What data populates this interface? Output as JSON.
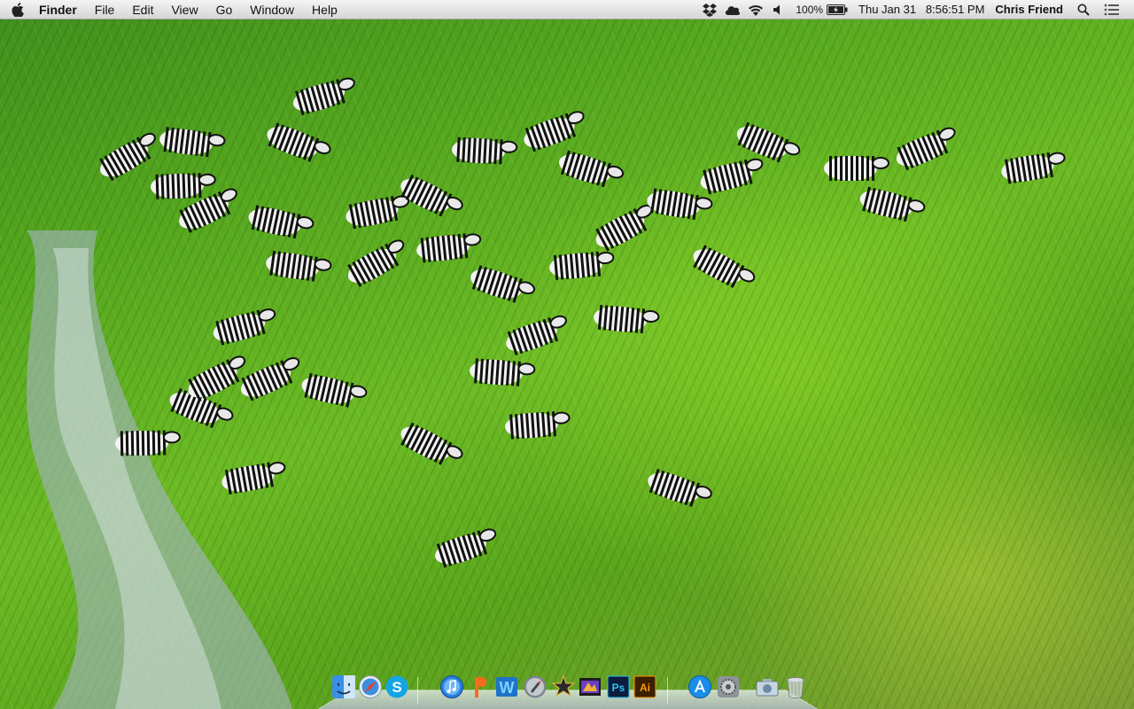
{
  "menubar": {
    "app_name": "Finder",
    "menus": [
      "File",
      "Edit",
      "View",
      "Go",
      "Window",
      "Help"
    ],
    "battery": "100%",
    "clock": "Thu Jan 31   8:56:51 PM",
    "user": "Chris Friend"
  },
  "status_icons": [
    "dropbox-icon",
    "cloud-icon",
    "wifi-icon",
    "volume-icon",
    "battery-icon",
    "spotlight-icon",
    "notification-center-icon"
  ],
  "dock": {
    "items": [
      {
        "name": "finder",
        "label_text": ""
      },
      {
        "name": "safari",
        "label_text": ""
      },
      {
        "name": "skype",
        "label_text": "S"
      },
      {
        "name": "itunes",
        "label_text": ""
      },
      {
        "name": "pages",
        "label_text": ""
      },
      {
        "name": "word",
        "label_text": "W"
      },
      {
        "name": "launchpad",
        "label_text": ""
      },
      {
        "name": "imovie",
        "label_text": ""
      },
      {
        "name": "final-cut",
        "label_text": ""
      },
      {
        "name": "photoshop",
        "label_text": "Ps"
      },
      {
        "name": "illustrator",
        "label_text": "Ai"
      },
      {
        "name": "app-store",
        "label_text": ""
      },
      {
        "name": "system-preferences",
        "label_text": ""
      },
      {
        "name": "image-capture",
        "label_text": ""
      },
      {
        "name": "trash",
        "label_text": ""
      }
    ]
  },
  "colors": {
    "grass": "#5aa51c",
    "menubar": "#e8e8e8",
    "skype": "#12a5e6",
    "photoshop": "#0b1c3c",
    "illustrator": "#3a1f00"
  }
}
